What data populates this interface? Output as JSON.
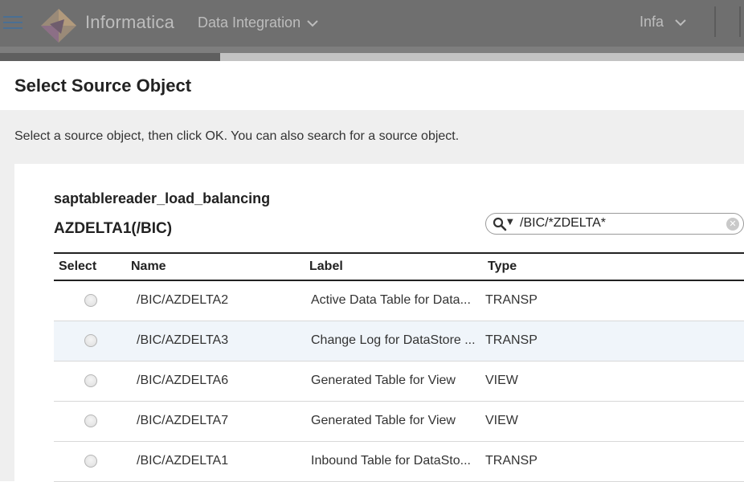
{
  "header": {
    "brand": "Informatica",
    "product": "Data Integration",
    "user": "Infa"
  },
  "dialog": {
    "title": "Select Source Object",
    "instruction": "Select a source object, then click OK. You can also search for a source object.",
    "connection": "saptablereader_load_balancing",
    "package": "AZDELTA1(/BIC)",
    "search": {
      "value": "/BIC/*ZDELTA*"
    },
    "columns": [
      "Select",
      "Name",
      "Label",
      "Type"
    ],
    "rows": [
      {
        "name": "/BIC/AZDELTA2",
        "label": "Active Data Table for Data...",
        "type": "TRANSP"
      },
      {
        "name": "/BIC/AZDELTA3",
        "label": "Change Log for DataStore ...",
        "type": "TRANSP"
      },
      {
        "name": "/BIC/AZDELTA6",
        "label": "Generated Table for View",
        "type": "VIEW"
      },
      {
        "name": "/BIC/AZDELTA7",
        "label": "Generated Table for View",
        "type": "VIEW"
      },
      {
        "name": "/BIC/AZDELTA1",
        "label": "Inbound Table for DataSto...",
        "type": "TRANSP"
      }
    ]
  }
}
